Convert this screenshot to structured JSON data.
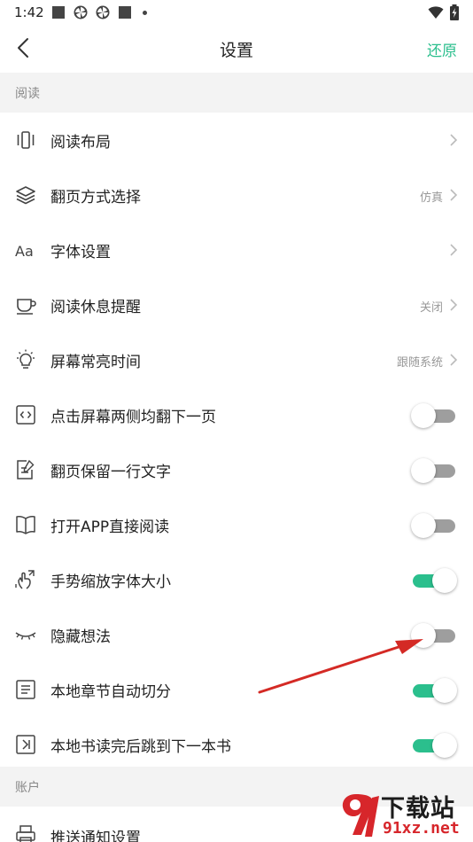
{
  "status_bar": {
    "time": "1:42",
    "icons": [
      "square-notification-icon",
      "pinwheel-icon",
      "pinwheel-icon",
      "square-notification-icon",
      "dot-icon",
      "wifi-icon",
      "battery-charging-icon"
    ]
  },
  "header": {
    "title": "设置",
    "restore_label": "还原",
    "accent_color": "#2bbf8d"
  },
  "sections": {
    "reading_title": "阅读",
    "account_title": "账户"
  },
  "rows": [
    {
      "label": "阅读布局",
      "icon": "layout-icon",
      "value": "",
      "control": "chevron"
    },
    {
      "label": "翻页方式选择",
      "icon": "layers-icon",
      "value": "仿真",
      "control": "chevron"
    },
    {
      "label": "字体设置",
      "icon": "font-icon",
      "value": "",
      "control": "chevron"
    },
    {
      "label": "阅读休息提醒",
      "icon": "coffee-cup-icon",
      "value": "关闭",
      "control": "chevron"
    },
    {
      "label": "屏幕常亮时间",
      "icon": "lightbulb-icon",
      "value": "跟随系统",
      "control": "chevron"
    },
    {
      "label": "点击屏幕两侧均翻下一页",
      "icon": "code-brackets-icon",
      "on": false,
      "control": "toggle"
    },
    {
      "label": "翻页保留一行文字",
      "icon": "edit-note-icon",
      "on": false,
      "control": "toggle"
    },
    {
      "label": "打开APP直接阅读",
      "icon": "open-book-icon",
      "on": false,
      "control": "toggle"
    },
    {
      "label": "手势缩放字体大小",
      "icon": "pinch-gesture-icon",
      "on": true,
      "control": "toggle"
    },
    {
      "label": "隐藏想法",
      "icon": "closed-eye-icon",
      "on": false,
      "control": "toggle"
    },
    {
      "label": "本地章节自动切分",
      "icon": "list-doc-icon",
      "on": true,
      "control": "toggle"
    },
    {
      "label": "本地书读完后跳到下一本书",
      "icon": "next-book-icon",
      "on": true,
      "control": "toggle"
    }
  ],
  "account_rows": [
    {
      "label": "推送通知设置",
      "icon": "notification-printer-icon"
    }
  ],
  "watermark": {
    "top_text": "下载站",
    "bottom_text": "91xz.net"
  },
  "annotation": {
    "arrow_color": "#d42a25",
    "points_to": "隐藏想法"
  }
}
